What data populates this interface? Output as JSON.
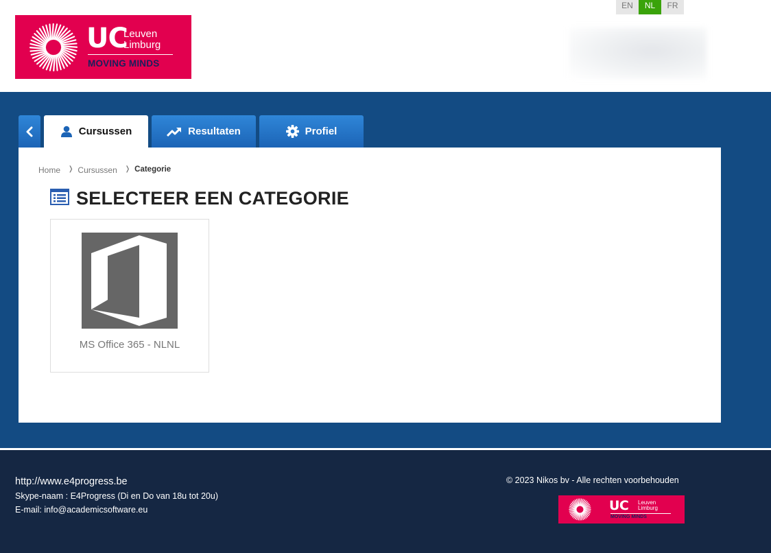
{
  "header": {
    "logo": {
      "uc": "UC",
      "leuven": "Leuven",
      "limburg": "Limburg",
      "tagline": "MOVING MINDS",
      "brand_color": "#e2004f"
    },
    "languages": [
      {
        "code": "EN",
        "active": false
      },
      {
        "code": "NL",
        "active": true
      },
      {
        "code": "FR",
        "active": false
      }
    ]
  },
  "nav": {
    "back_icon": "chevron-left-icon",
    "tabs": [
      {
        "label": "Cursussen",
        "icon": "user-icon",
        "active": true
      },
      {
        "label": "Resultaten",
        "icon": "trending-up-icon",
        "active": false
      },
      {
        "label": "Profiel",
        "icon": "gear-icon",
        "active": false
      }
    ]
  },
  "breadcrumb": {
    "items": [
      "Home",
      "Cursussen",
      "Categorie"
    ],
    "separator": "❭"
  },
  "main": {
    "title": "SELECTEER EEN CATEGORIE",
    "title_icon": "list-icon",
    "categories": [
      {
        "name": "MS Office 365 - NLNL",
        "icon": "ms-office-icon"
      }
    ]
  },
  "footer": {
    "url": "http://www.e4progress.be",
    "skype": "Skype-naam : E4Progress (Di en Do van 18u tot 20u)",
    "email": "E-mail: info@academicsoftware.eu",
    "copyright": "© 2023 Nikos bv - Alle rechten voorbehouden",
    "logo": {
      "uc": "UC",
      "leuven": "Leuven",
      "limburg": "Limburg",
      "tagline": "MOVING MINDS"
    }
  },
  "colors": {
    "band": "#134b83",
    "footer": "#152743",
    "tab_blue": "#1c64b6",
    "lang_active": "#3aa30a"
  }
}
